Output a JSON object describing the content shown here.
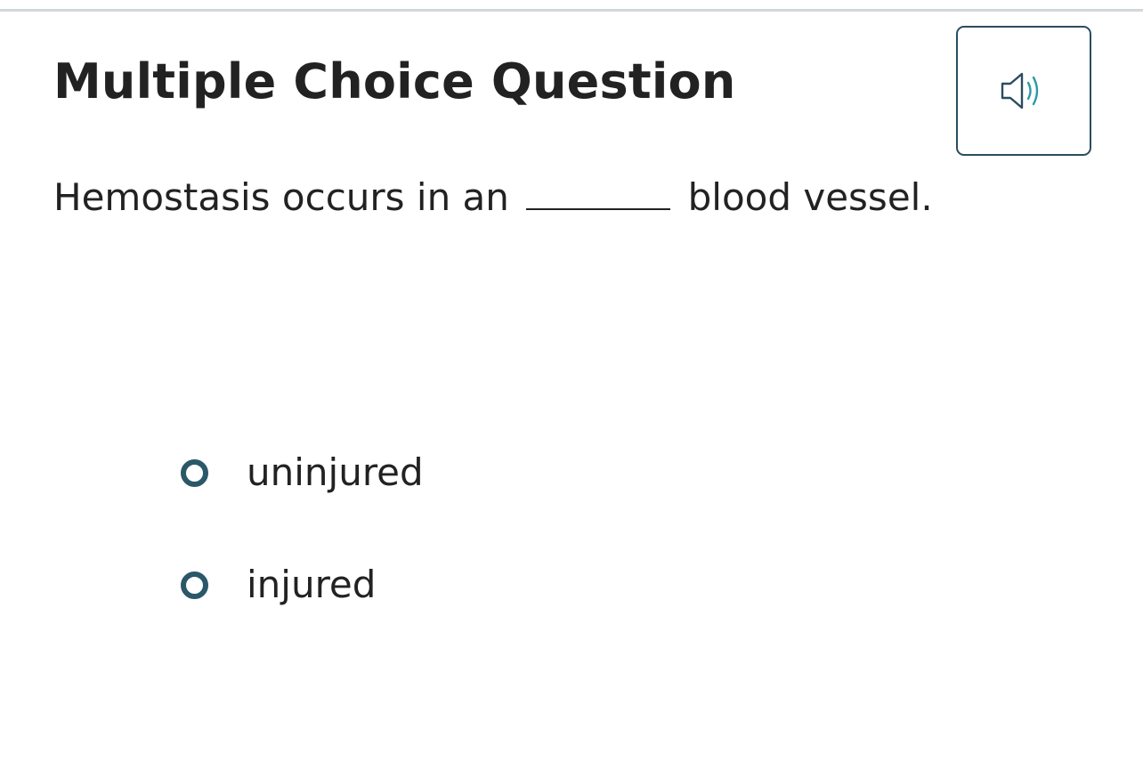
{
  "header": {
    "title": "Multiple Choice Question",
    "audio_button": {
      "icon": "speaker-icon",
      "colors": {
        "border": "#2a4d60",
        "speaker": "#2a4d60",
        "waves": "#2a9aa8"
      }
    }
  },
  "question": {
    "text_before": "Hemostasis occurs in an",
    "blank": "_______",
    "text_after": "blood vessel."
  },
  "options": [
    {
      "label": "uninjured",
      "selected": false
    },
    {
      "label": "injured",
      "selected": false
    }
  ],
  "colors": {
    "radio_ring": "#2a5869",
    "text": "#222222",
    "top_rule": "#d1d7db"
  }
}
